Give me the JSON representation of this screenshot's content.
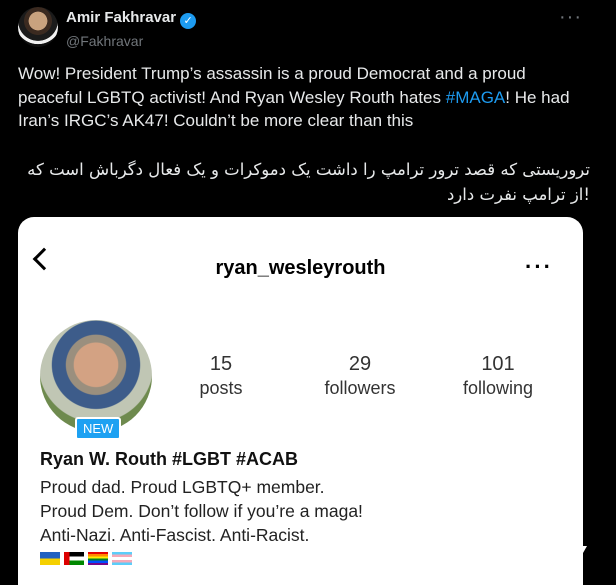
{
  "author": {
    "name": "Amir Fakhravar",
    "handle": "@Fakhravar",
    "verified_icon": "verified-badge-icon"
  },
  "more_icon": "more-horizontal-icon",
  "tweet": {
    "text_part1": "Wow! President Trump’s assassin is a proud Democrat and a proud peaceful LGBTQ activist! And Ryan Wesley Routh hates ",
    "hashtag": "#MAGA",
    "text_part2": "! He had Iran’s IRGC’s AK47! Couldn’t be more clear than this",
    "persian_line1": "تروریستی که قصد ترور ترامپ را داشت یک دموکرات و یک فعال دگرباش است که",
    "persian_line2": "!از ترامپ نفرت دارد"
  },
  "instagram": {
    "username": "ryan_wesleyrouth",
    "new_badge": "NEW",
    "stats": [
      {
        "num": "15",
        "label": "posts"
      },
      {
        "num": "29",
        "label": "followers"
      },
      {
        "num": "101",
        "label": "following"
      }
    ],
    "display_name": "Ryan W. Routh #LGBT #ACAB",
    "bio": [
      "Proud dad. Proud LGBTQ+ member.",
      "Proud Dem. Don’t follow if you’re a maga!",
      "Anti-Nazi. Anti-Fascist. Anti-Racist."
    ],
    "flags": [
      "ukraine-flag-icon",
      "palestine-flag-icon",
      "rainbow-flag-icon",
      "transgender-flag-icon"
    ]
  },
  "colors": {
    "background": "#000000",
    "link": "#1d9bf0",
    "badge": "#1da1f2"
  }
}
